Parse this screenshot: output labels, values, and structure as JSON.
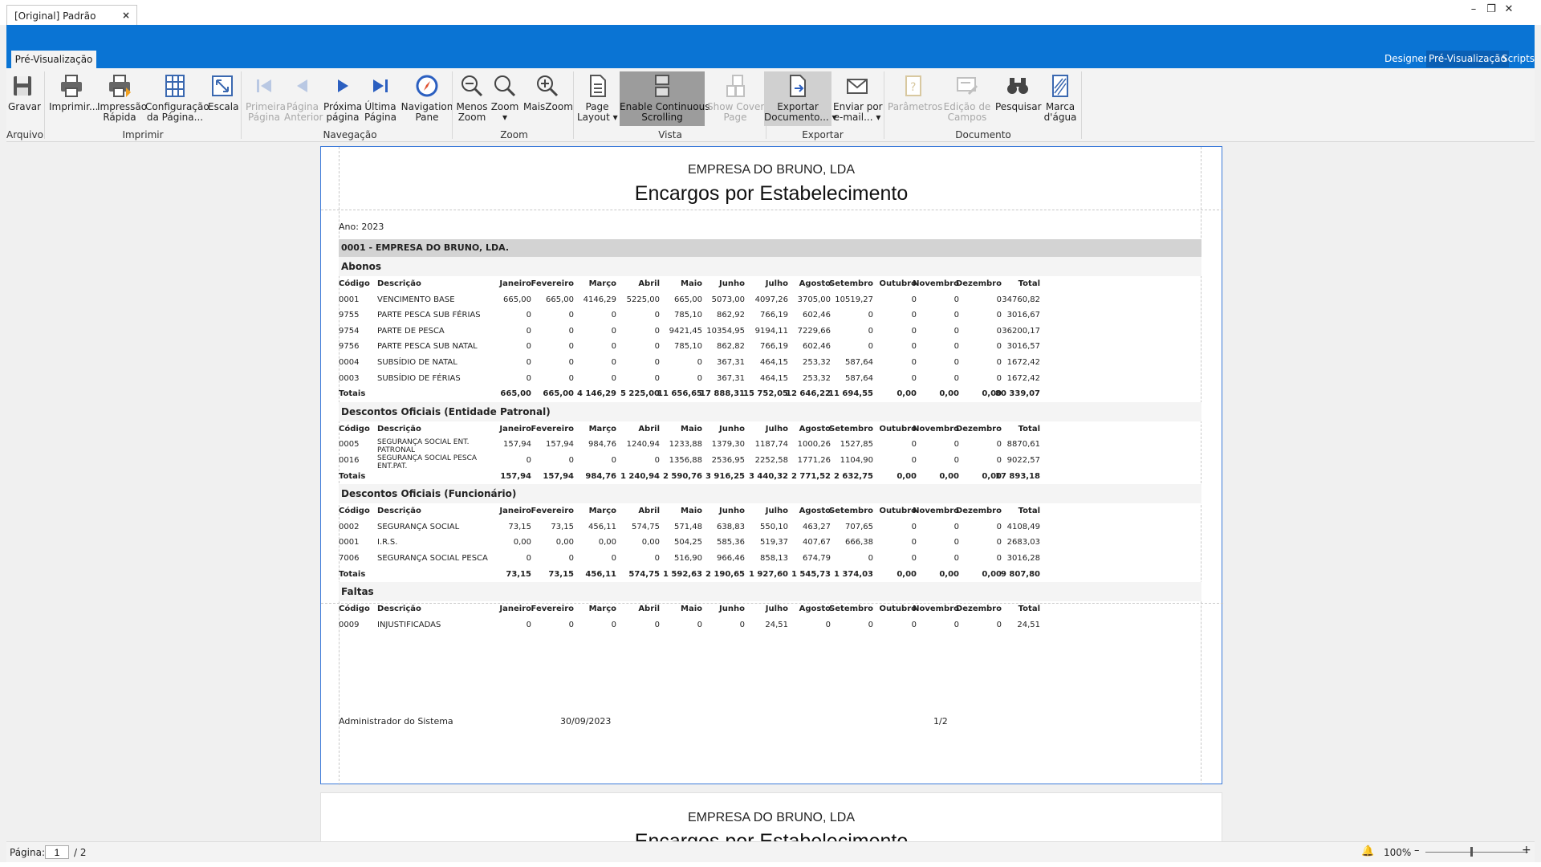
{
  "window": {
    "tab_title": "[Original] Padrão",
    "close_glyph": "×",
    "minimize_glyph": "–",
    "restore_glyph": "❐",
    "close_window_glyph": "✕"
  },
  "ribbon": {
    "active_tab": "Pré-Visualização",
    "right_tabs": [
      "Designer",
      "Pré-Visualização",
      "Scripts"
    ],
    "dropdown_glyph": "▾",
    "groups": {
      "arquivo": "Arquivo",
      "imprimir": "Imprimir",
      "navegacao": "Navegação",
      "zoom": "Zoom",
      "vista": "Vista",
      "exportar": "Exportar",
      "documento": "Documento"
    },
    "buttons": {
      "gravar": "Gravar",
      "imprimir": "Imprimir...",
      "impressao_rapida_1": "Impressão",
      "impressao_rapida_2": "Rápida",
      "configuracao_1": "Configuração",
      "configuracao_2": "da Página...",
      "escala": "Escala",
      "primeira_1": "Primeira",
      "primeira_2": "Página",
      "anterior_1": "Página",
      "anterior_2": "Anterior",
      "proxima_1": "Próxima",
      "proxima_2": "página",
      "ultima_1": "Última",
      "ultima_2": "Página",
      "nav_pane_1": "Navigation",
      "nav_pane_2": "Pane",
      "menos_1": "Menos",
      "menos_2": "Zoom",
      "zoom": "Zoom",
      "maiszoom": "MaisZoom",
      "page_layout_1": "Page",
      "page_layout_2": "Layout ▾",
      "continuous_1": "Enable Continuous",
      "continuous_2": "Scrolling",
      "cover_1": "Show Cover",
      "cover_2": "Page",
      "exportar_1": "Exportar",
      "exportar_2": "Documento... ▾",
      "enviar_1": "Enviar por",
      "enviar_2": "e-mail... ▾",
      "parametros": "Parâmetros",
      "edicao_1": "Edição de",
      "edicao_2": "Campos",
      "pesquisar": "Pesquisar",
      "marca_1": "Marca",
      "marca_2": "d'água"
    }
  },
  "report": {
    "company": "EMPRESA DO BRUNO, LDA",
    "title": "Encargos por Estabelecimento",
    "year_line": "Ano: 2023",
    "company_row": "0001 - EMPRESA DO BRUNO, LDA.",
    "columns": [
      "Código",
      "Descrição",
      "Janeiro",
      "Fevereiro",
      "Março",
      "Abril",
      "Maio",
      "Junho",
      "Julho",
      "Agosto",
      "Setembro",
      "Outubro",
      "Novembro",
      "Dezembro",
      "Total"
    ],
    "sections": [
      {
        "name": "Abonos",
        "rows": [
          [
            "0001",
            "VENCIMENTO BASE",
            "665,00",
            "665,00",
            "4146,29",
            "5225,00",
            "665,00",
            "5073,00",
            "4097,26",
            "3705,00",
            "10519,27",
            "0",
            "0",
            "0",
            "34760,82"
          ],
          [
            "9755",
            "PARTE PESCA SUB FÉRIAS",
            "0",
            "0",
            "0",
            "0",
            "785,10",
            "862,92",
            "766,19",
            "602,46",
            "0",
            "0",
            "0",
            "0",
            "3016,67"
          ],
          [
            "9754",
            "PARTE DE PESCA",
            "0",
            "0",
            "0",
            "0",
            "9421,45",
            "10354,95",
            "9194,11",
            "7229,66",
            "0",
            "0",
            "0",
            "0",
            "36200,17"
          ],
          [
            "9756",
            "PARTE PESCA SUB NATAL",
            "0",
            "0",
            "0",
            "0",
            "785,10",
            "862,82",
            "766,19",
            "602,46",
            "0",
            "0",
            "0",
            "0",
            "3016,57"
          ],
          [
            "0004",
            "SUBSÍDIO DE NATAL",
            "0",
            "0",
            "0",
            "0",
            "0",
            "367,31",
            "464,15",
            "253,32",
            "587,64",
            "0",
            "0",
            "0",
            "1672,42"
          ],
          [
            "0003",
            "SUBSÍDIO DE FÉRIAS",
            "0",
            "0",
            "0",
            "0",
            "0",
            "367,31",
            "464,15",
            "253,32",
            "587,64",
            "0",
            "0",
            "0",
            "1672,42"
          ]
        ],
        "totals": [
          "Totais",
          "",
          "665,00",
          "665,00",
          "4 146,29",
          "5 225,00",
          "11 656,65",
          "17 888,31",
          "15 752,05",
          "12 646,22",
          "11 694,55",
          "0,00",
          "0,00",
          "0,00",
          "80 339,07"
        ]
      },
      {
        "name": "Descontos Oficiais (Entidade Patronal)",
        "rows": [
          [
            "0005",
            "SEGURANÇA SOCIAL ENT. PATRONAL",
            "157,94",
            "157,94",
            "984,76",
            "1240,94",
            "1233,88",
            "1379,30",
            "1187,74",
            "1000,26",
            "1527,85",
            "0",
            "0",
            "0",
            "8870,61"
          ],
          [
            "0016",
            "SEGURANÇA SOCIAL PESCA ENT.PAT.",
            "0",
            "0",
            "0",
            "0",
            "1356,88",
            "2536,95",
            "2252,58",
            "1771,26",
            "1104,90",
            "0",
            "0",
            "0",
            "9022,57"
          ]
        ],
        "totals": [
          "Totais",
          "",
          "157,94",
          "157,94",
          "984,76",
          "1 240,94",
          "2 590,76",
          "3 916,25",
          "3 440,32",
          "2 771,52",
          "2 632,75",
          "0,00",
          "0,00",
          "0,00",
          "17 893,18"
        ]
      },
      {
        "name": "Descontos Oficiais (Funcionário)",
        "rows": [
          [
            "0002",
            "SEGURANÇA SOCIAL",
            "73,15",
            "73,15",
            "456,11",
            "574,75",
            "571,48",
            "638,83",
            "550,10",
            "463,27",
            "707,65",
            "0",
            "0",
            "0",
            "4108,49"
          ],
          [
            "0001",
            "I.R.S.",
            "0,00",
            "0,00",
            "0,00",
            "0,00",
            "504,25",
            "585,36",
            "519,37",
            "407,67",
            "666,38",
            "0",
            "0",
            "0",
            "2683,03"
          ],
          [
            "7006",
            "SEGURANÇA SOCIAL PESCA",
            "0",
            "0",
            "0",
            "0",
            "516,90",
            "966,46",
            "858,13",
            "674,79",
            "0",
            "0",
            "0",
            "0",
            "3016,28"
          ]
        ],
        "totals": [
          "Totais",
          "",
          "73,15",
          "73,15",
          "456,11",
          "574,75",
          "1 592,63",
          "2 190,65",
          "1 927,60",
          "1 545,73",
          "1 374,03",
          "0,00",
          "0,00",
          "0,00",
          "9 807,80"
        ]
      },
      {
        "name": "Faltas",
        "rows": [
          [
            "0009",
            "INJUSTIFICADAS",
            "0",
            "0",
            "0",
            "0",
            "0",
            "0",
            "24,51",
            "0",
            "0",
            "0",
            "0",
            "0",
            "24,51"
          ]
        ]
      }
    ],
    "footer": {
      "user": "Administrador do Sistema",
      "date": "30/09/2023",
      "page": "1/2"
    }
  },
  "status": {
    "page_label": "Página:",
    "current_page": "1",
    "total_pages": "/ 2",
    "zoom": "100%",
    "bell_glyph": "🔔",
    "minus_glyph": "–",
    "plus_glyph": "+"
  },
  "colors": {
    "ribbon_band": "#0a74d4",
    "active_tab_highlight": "#0a5fb4",
    "page_border": "#3d7bd9",
    "company_row_bg": "#d3d3d3"
  }
}
